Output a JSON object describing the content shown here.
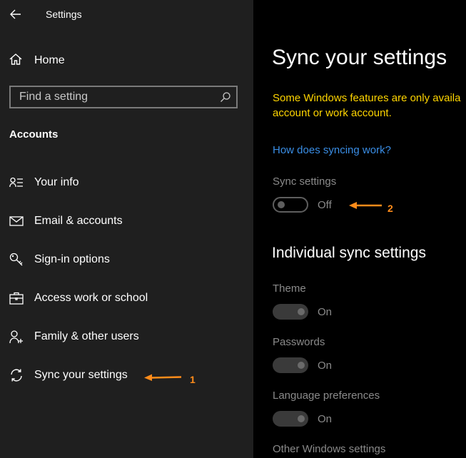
{
  "window": {
    "title": "Settings"
  },
  "sidebar": {
    "home_label": "Home",
    "search": {
      "placeholder": "Find a setting"
    },
    "section_title": "Accounts",
    "items": [
      {
        "label": "Your info",
        "icon": "person-info-icon"
      },
      {
        "label": "Email & accounts",
        "icon": "mail-icon"
      },
      {
        "label": "Sign-in options",
        "icon": "key-icon"
      },
      {
        "label": "Access work or school",
        "icon": "briefcase-icon"
      },
      {
        "label": "Family & other users",
        "icon": "person-add-icon"
      },
      {
        "label": "Sync your settings",
        "icon": "sync-icon"
      }
    ]
  },
  "main": {
    "title": "Sync your settings",
    "notice_lines": [
      "Some Windows features are only availa",
      "account or work account."
    ],
    "link": "How does syncing work?",
    "sync_settings": {
      "label": "Sync settings",
      "state": "Off"
    },
    "individual_heading": "Individual sync settings",
    "individual": [
      {
        "label": "Theme",
        "state": "On"
      },
      {
        "label": "Passwords",
        "state": "On"
      },
      {
        "label": "Language preferences",
        "state": "On"
      },
      {
        "label": "Other Windows settings"
      }
    ]
  },
  "annotations": {
    "one": "1",
    "two": "2"
  },
  "colors": {
    "accent_link": "#3a8ee6",
    "notice": "#ffd500",
    "annotation": "#ff8c1a"
  }
}
